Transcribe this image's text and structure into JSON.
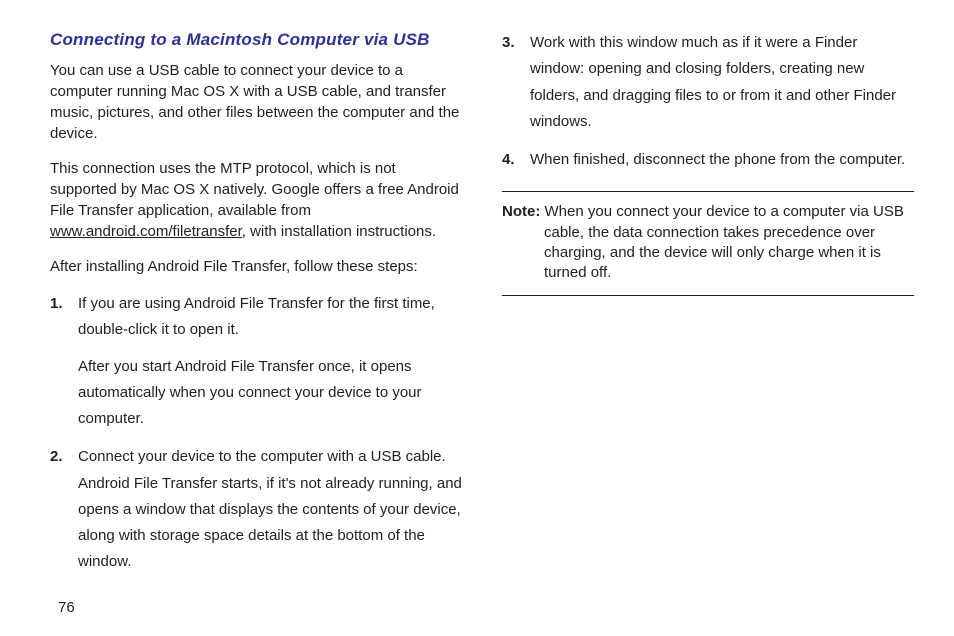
{
  "heading": "Connecting to a Macintosh Computer via USB",
  "para1": "You can use a USB cable to connect your device to a computer running Mac OS X with a USB cable, and transfer music, pictures, and other files between the computer and the device.",
  "para2_pre": "This connection uses the MTP protocol, which is not supported by Mac OS X natively. Google offers a free Android File Transfer application, available from ",
  "para2_link": "www.android.com/filetransfer",
  "para2_post": ", with installation instructions.",
  "para3": "After installing Android File Transfer, follow these steps:",
  "steps": {
    "s1_num": "1.",
    "s1_text": "If you are using Android File Transfer for the first time, double-click it to open it.",
    "s1_sub": "After you start Android File Transfer once, it opens automatically when you connect your device to your computer.",
    "s2_num": "2.",
    "s2_text": "Connect your device to the computer with a USB cable. Android File Transfer starts, if it's not already running, and opens a window that displays the contents of your device, along with storage space details at the bottom of the window.",
    "s3_num": "3.",
    "s3_text": "Work with this window much as if it were a Finder window: opening and closing folders, creating new folders, and dragging files to or from it and other Finder windows.",
    "s4_num": "4.",
    "s4_text": "When finished, disconnect the phone from the computer."
  },
  "note_label": "Note:",
  "note_text": " When you connect your device to a computer via USB cable, the data connection takes precedence over charging, and the device will only charge when it is turned off.",
  "page_number": "76"
}
